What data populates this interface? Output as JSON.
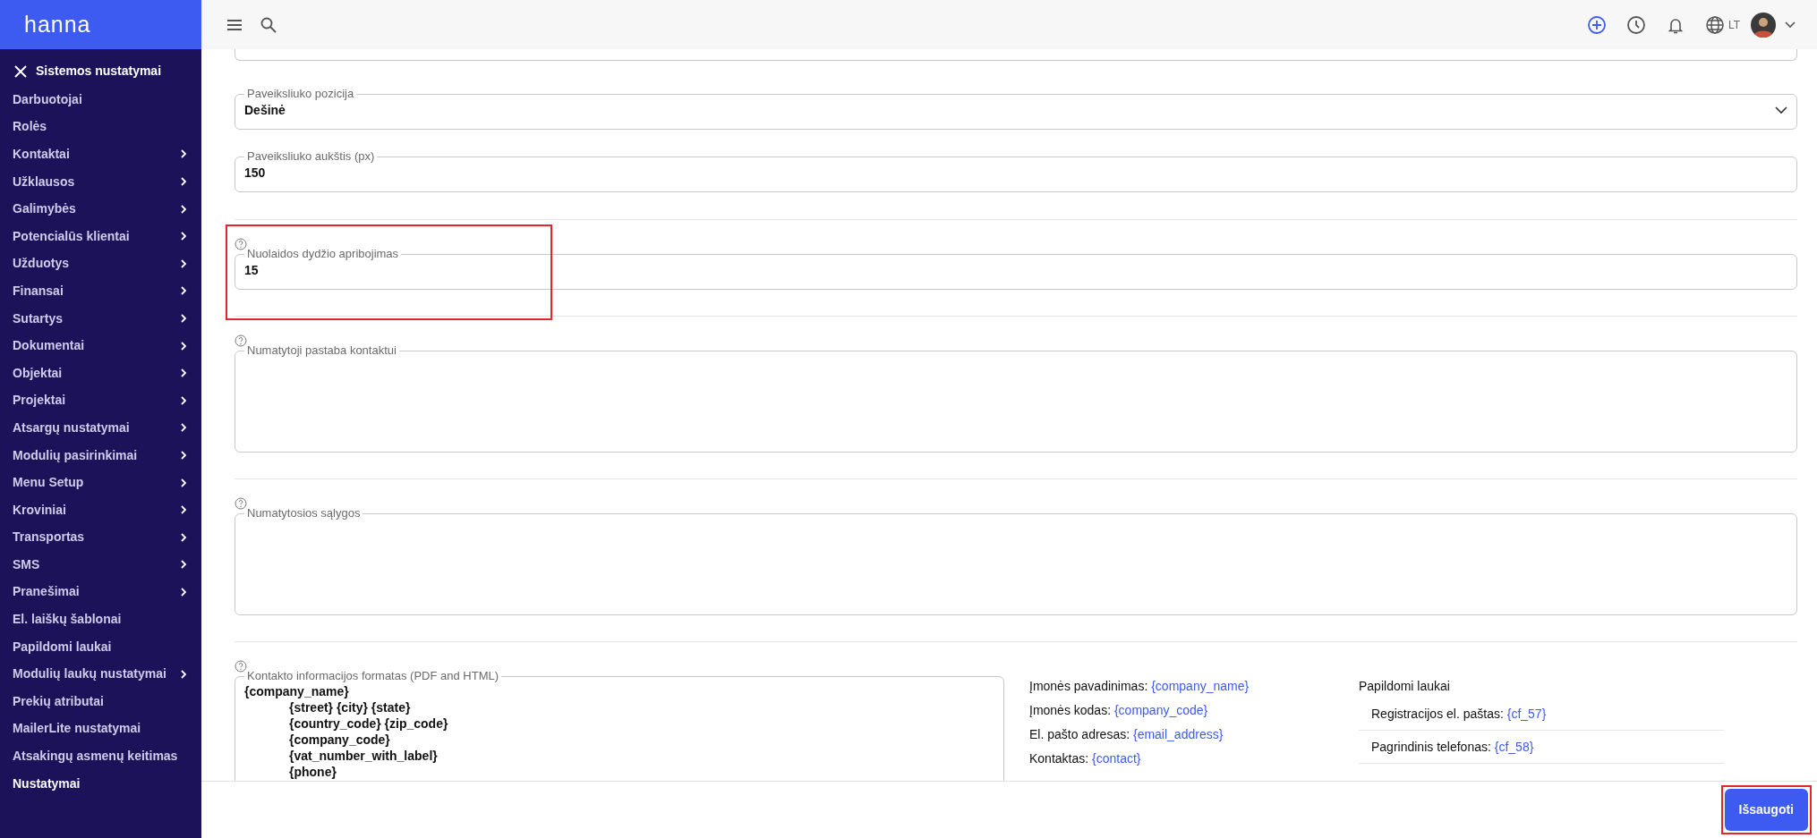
{
  "logo": "hanna",
  "sidebar": {
    "title": "Sistemos nustatymai",
    "items": [
      {
        "label": "Darbuotojai",
        "has_submenu": false,
        "selected": false
      },
      {
        "label": "Rolės",
        "has_submenu": false,
        "selected": false
      },
      {
        "label": "Kontaktai",
        "has_submenu": true,
        "selected": false
      },
      {
        "label": "Užklausos",
        "has_submenu": true,
        "selected": false
      },
      {
        "label": "Galimybės",
        "has_submenu": true,
        "selected": false
      },
      {
        "label": "Potencialūs klientai",
        "has_submenu": true,
        "selected": false
      },
      {
        "label": "Užduotys",
        "has_submenu": true,
        "selected": false
      },
      {
        "label": "Finansai",
        "has_submenu": true,
        "selected": false
      },
      {
        "label": "Sutartys",
        "has_submenu": true,
        "selected": false
      },
      {
        "label": "Dokumentai",
        "has_submenu": true,
        "selected": false
      },
      {
        "label": "Objektai",
        "has_submenu": true,
        "selected": false
      },
      {
        "label": "Projektai",
        "has_submenu": true,
        "selected": false
      },
      {
        "label": "Atsargų nustatymai",
        "has_submenu": true,
        "selected": false
      },
      {
        "label": "Modulių pasirinkimai",
        "has_submenu": true,
        "selected": false
      },
      {
        "label": "Menu Setup",
        "has_submenu": true,
        "selected": false
      },
      {
        "label": "Kroviniai",
        "has_submenu": true,
        "selected": false
      },
      {
        "label": "Transportas",
        "has_submenu": true,
        "selected": false
      },
      {
        "label": "SMS",
        "has_submenu": true,
        "selected": false
      },
      {
        "label": "Pranešimai",
        "has_submenu": true,
        "selected": false
      },
      {
        "label": "El. laiškų šablonai",
        "has_submenu": false,
        "selected": false
      },
      {
        "label": "Papildomi laukai",
        "has_submenu": false,
        "selected": false
      },
      {
        "label": "Modulių laukų nustatymai",
        "has_submenu": true,
        "selected": false
      },
      {
        "label": "Prekių atributai",
        "has_submenu": false,
        "selected": false
      },
      {
        "label": "MailerLite nustatymai",
        "has_submenu": false,
        "selected": false
      },
      {
        "label": "Atsakingų asmenų keitimas",
        "has_submenu": false,
        "selected": false
      },
      {
        "label": "Nustatymai",
        "has_submenu": false,
        "selected": true
      }
    ]
  },
  "topbar": {
    "language": "LT"
  },
  "sections": [
    {
      "fields": [
        {
          "kind": "partial"
        },
        {
          "kind": "select",
          "label": "Paveiksliuko pozicija",
          "value": "Dešinė"
        },
        {
          "kind": "input",
          "label": "Paveiksliuko aukštis (px)",
          "value": "150"
        }
      ]
    },
    {
      "fields": [
        {
          "kind": "input",
          "label": "Nuolaidos dydžio apribojimas",
          "value": "15",
          "help": true,
          "highlighted": true
        }
      ]
    },
    {
      "fields": [
        {
          "kind": "textarea",
          "label": "Numatytoji pastaba kontaktui",
          "help": true
        }
      ]
    },
    {
      "fields": [
        {
          "kind": "textarea",
          "label": "Numatytosios sąlygos",
          "help": true
        }
      ]
    },
    {
      "fields": [
        {
          "kind": "format",
          "label": "Kontakto informacijos formatas (PDF and HTML)",
          "help": true,
          "lines": [
            {
              "text": "{company_name}",
              "indent": false
            },
            {
              "text": "{street} {city} {state}",
              "indent": true
            },
            {
              "text": "{country_code} {zip_code}",
              "indent": true
            },
            {
              "text": "{company_code}",
              "indent": true
            },
            {
              "text": "{vat_number_with_label}",
              "indent": true
            },
            {
              "text": "{phone}",
              "indent": true
            }
          ],
          "placeholders": [
            {
              "label": "Įmonės pavadinimas:",
              "code": "{company_name}"
            },
            {
              "label": "Įmonės kodas:",
              "code": "{company_code}"
            },
            {
              "label": "El. pašto adresas:",
              "code": "{email_address}"
            },
            {
              "label": "Kontaktas:",
              "code": "{contact}"
            }
          ],
          "custom_title": "Papildomi laukai",
          "custom": [
            {
              "label": "Registracijos el. paštas:",
              "code": "{cf_57}"
            },
            {
              "label": "Pagrindinis telefonas:",
              "code": "{cf_58}"
            }
          ]
        }
      ]
    }
  ],
  "save_button": {
    "label": "Išsaugoti",
    "highlighted": true
  }
}
